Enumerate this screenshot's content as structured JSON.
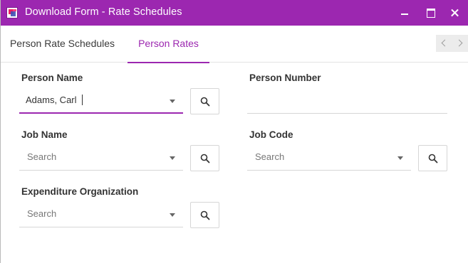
{
  "window": {
    "title": "Download Form - Rate Schedules",
    "icon": "app-logo-icon",
    "controls": [
      "minimize-icon",
      "maximize-icon",
      "close-icon"
    ],
    "accent_color": "#9c27b0"
  },
  "tabs": [
    {
      "label": "Person Rate Schedules",
      "active": false
    },
    {
      "label": "Person Rates",
      "active": true
    }
  ],
  "form": {
    "person_name": {
      "label": "Person Name",
      "value": "Adams, Carl"
    },
    "person_number": {
      "label": "Person Number",
      "value": ""
    },
    "job_name": {
      "label": "Job Name",
      "placeholder": "Search"
    },
    "job_code": {
      "label": "Job Code",
      "placeholder": "Search"
    },
    "expenditure_org": {
      "label": "Expenditure Organization",
      "placeholder": "Search"
    }
  }
}
